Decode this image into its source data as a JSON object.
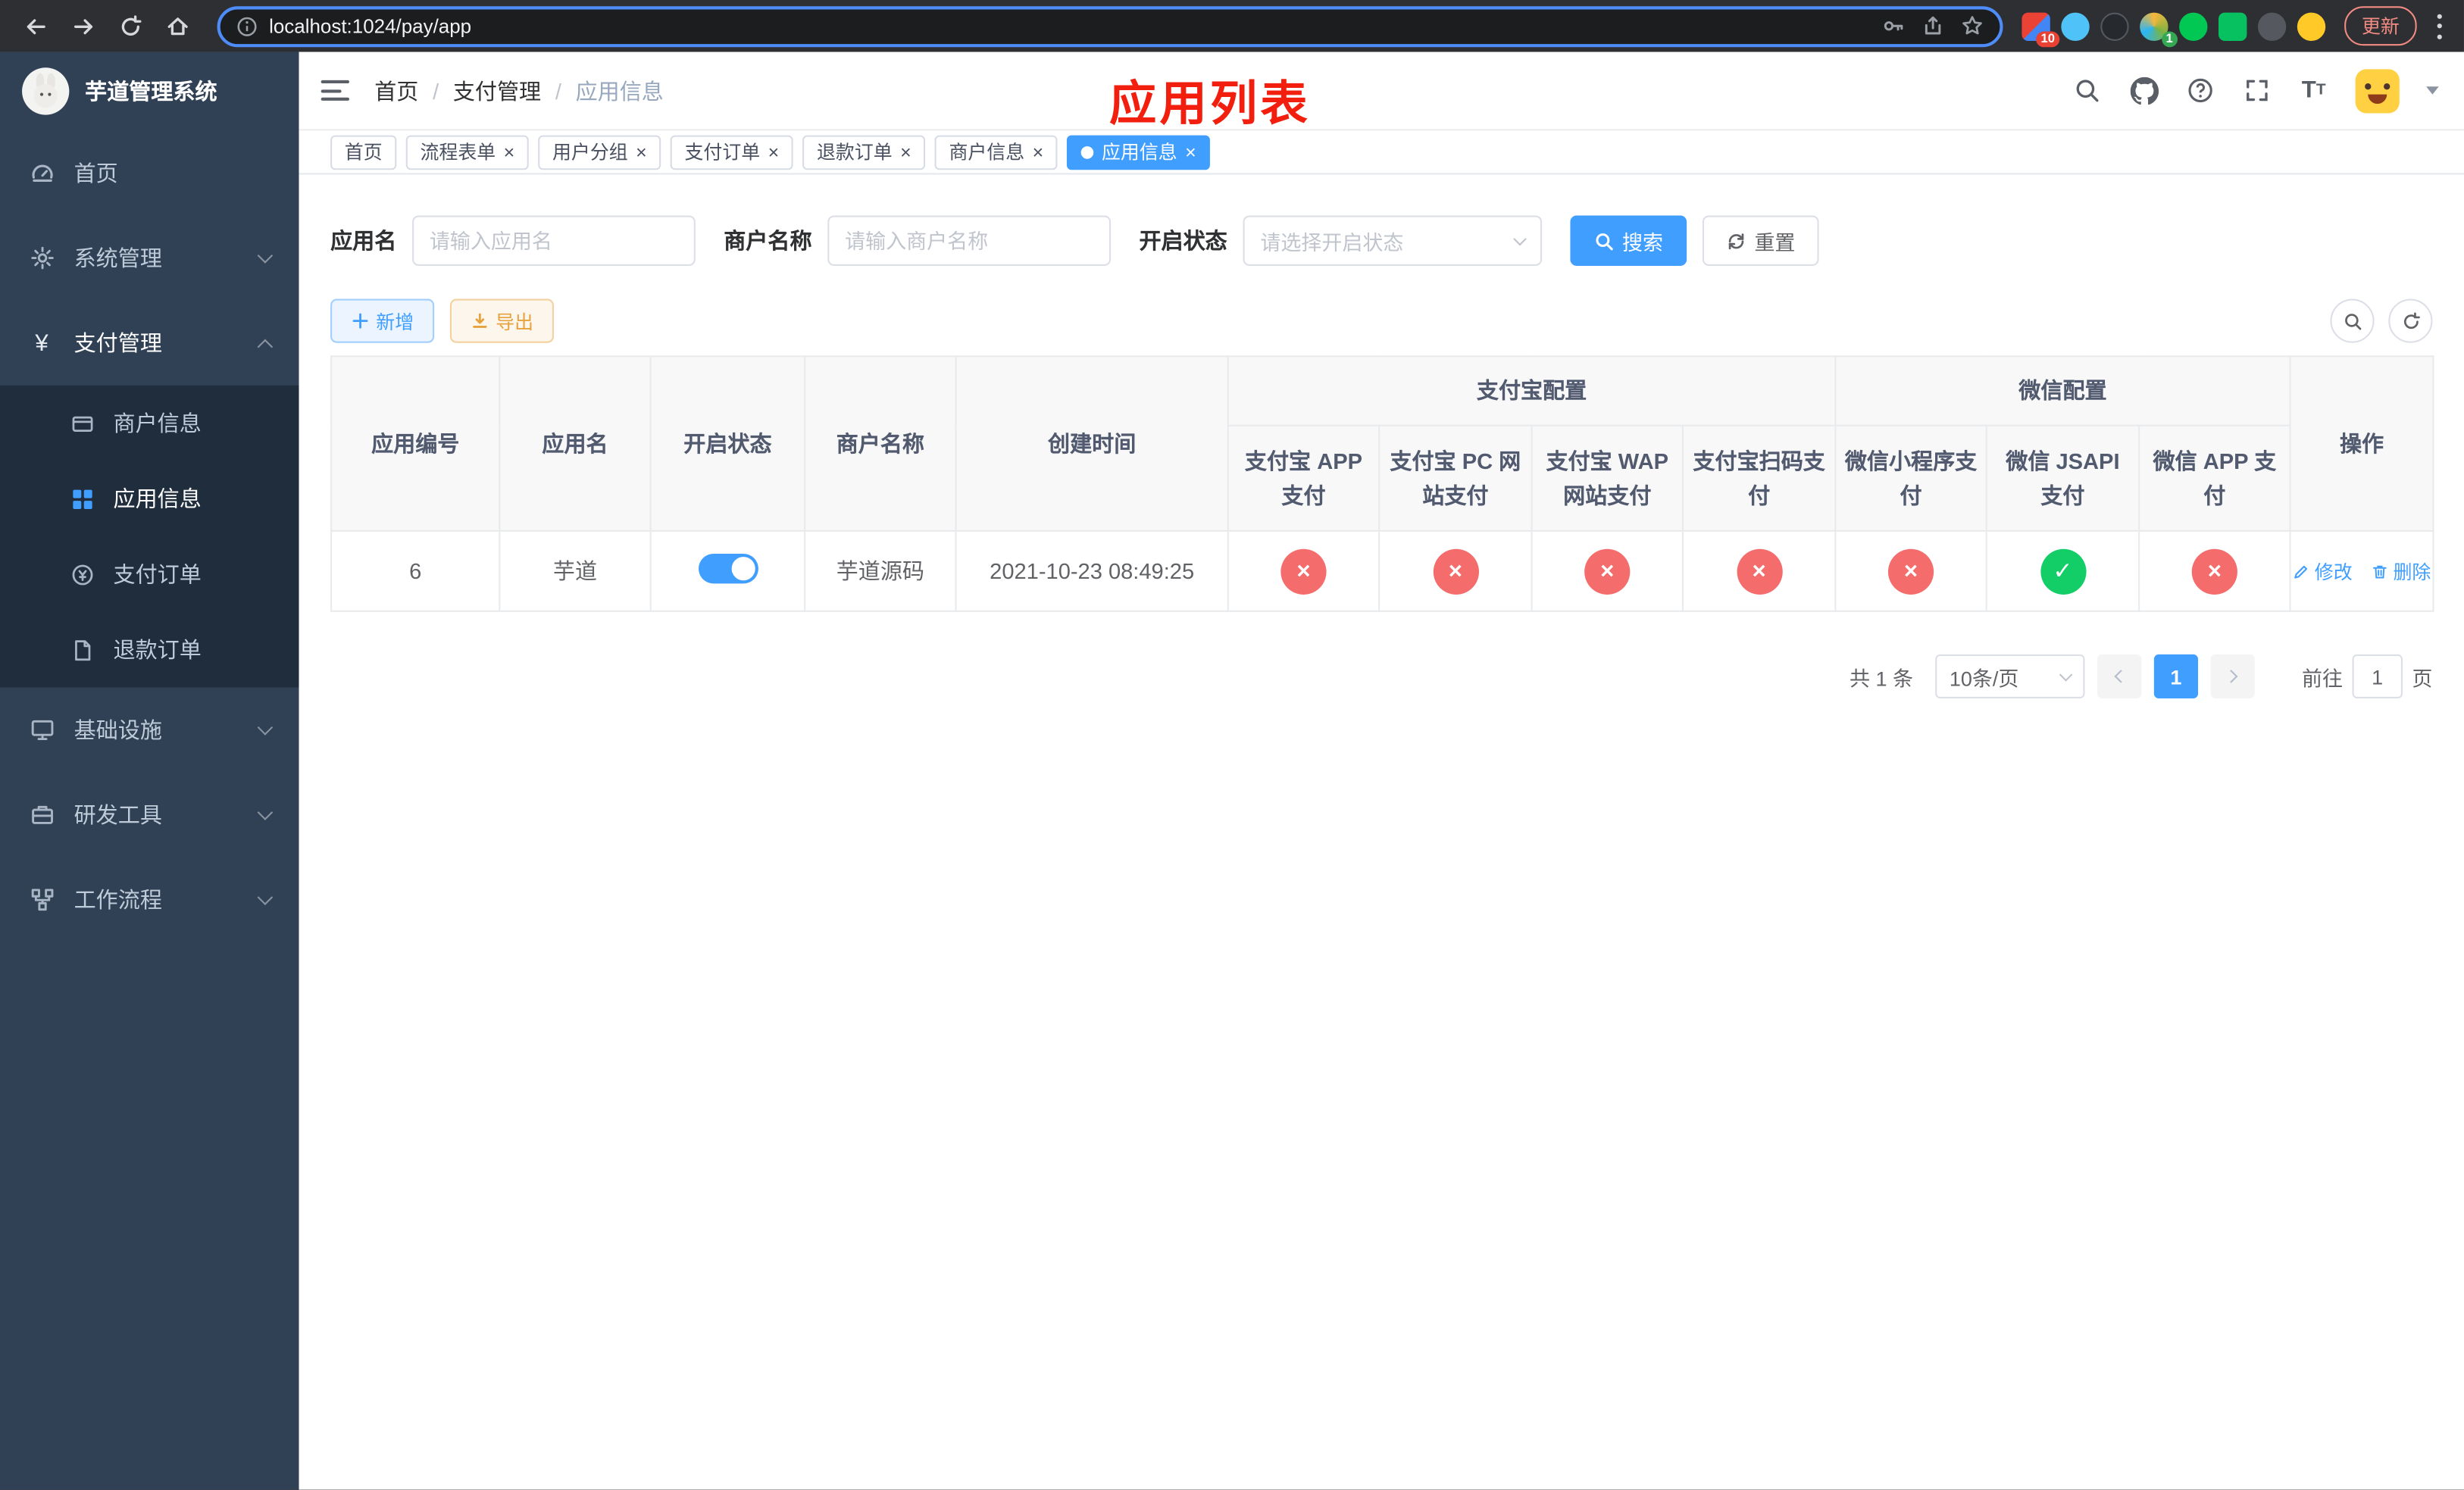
{
  "colors": {
    "primary": "#409eff",
    "danger": "#f56c6c",
    "success": "#13ce66",
    "sidebar": "#304156",
    "annotation": "#f21f0f"
  },
  "icons": {
    "yen": "¥",
    "close": "×",
    "check": "✓",
    "fail": "×",
    "plus": "＋",
    "question": "?"
  },
  "browser": {
    "url": "localhost:1024/pay/app",
    "update_label": "更新",
    "extension_badges": {
      "grid": "10",
      "profile": "1"
    }
  },
  "app": {
    "title": "芋道管理系统",
    "page_annotation": "应用列表"
  },
  "sidebar": {
    "items": [
      {
        "label": "首页"
      },
      {
        "label": "系统管理"
      },
      {
        "label": "支付管理"
      },
      {
        "label": "基础设施"
      },
      {
        "label": "研发工具"
      },
      {
        "label": "工作流程"
      }
    ],
    "pay_children": [
      {
        "label": "商户信息"
      },
      {
        "label": "应用信息"
      },
      {
        "label": "支付订单"
      },
      {
        "label": "退款订单"
      }
    ]
  },
  "breadcrumb": {
    "items": [
      "首页",
      "支付管理",
      "应用信息"
    ]
  },
  "tabs": [
    {
      "label": "首页",
      "closable": false
    },
    {
      "label": "流程表单",
      "closable": true
    },
    {
      "label": "用户分组",
      "closable": true
    },
    {
      "label": "支付订单",
      "closable": true
    },
    {
      "label": "退款订单",
      "closable": true
    },
    {
      "label": "商户信息",
      "closable": true
    },
    {
      "label": "应用信息",
      "closable": true,
      "active": true
    }
  ],
  "filters": {
    "app_name": {
      "label": "应用名",
      "placeholder": "请输入应用名",
      "value": ""
    },
    "merchant_name": {
      "label": "商户名称",
      "placeholder": "请输入商户名称",
      "value": ""
    },
    "status": {
      "label": "开启状态",
      "placeholder": "请选择开启状态",
      "value": ""
    },
    "search_label": "搜索",
    "reset_label": "重置"
  },
  "toolbar": {
    "add_label": "新增",
    "export_label": "导出"
  },
  "table": {
    "group_headers": {
      "alipay": "支付宝配置",
      "wechat": "微信配置"
    },
    "headers": {
      "app_id": "应用编号",
      "app_name": "应用名",
      "status": "开启状态",
      "merchant": "商户名称",
      "created": "创建时间",
      "alipay_app": "支付宝 APP 支付",
      "alipay_pc": "支付宝 PC 网站支付",
      "alipay_wap": "支付宝 WAP 网站支付",
      "alipay_qr": "支付宝扫码支付",
      "wx_mini": "微信小程序支付",
      "wx_jsapi": "微信 JSAPI 支付",
      "wx_app": "微信 APP 支付",
      "actions": "操作"
    },
    "rows": [
      {
        "app_id": "6",
        "app_name": "芋道",
        "status_on": true,
        "merchant": "芋道源码",
        "created": "2021-10-23 08:49:25",
        "channels": [
          "fail",
          "fail",
          "fail",
          "fail",
          "fail",
          "ok",
          "fail"
        ],
        "edit_label": "修改",
        "delete_label": "删除"
      }
    ]
  },
  "pagination": {
    "total": "共 1 条",
    "page_size": "10条/页",
    "page": "1",
    "goto_prefix": "前往",
    "goto_value": "1",
    "goto_suffix": "页"
  }
}
